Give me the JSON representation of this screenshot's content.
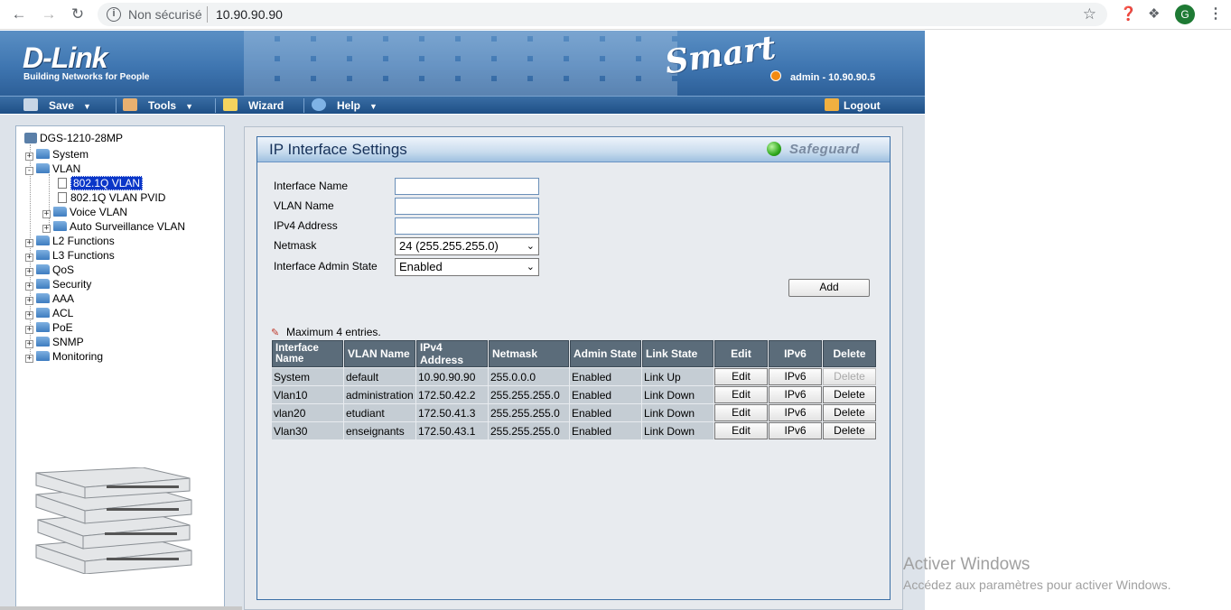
{
  "browser": {
    "back_icon": "arrow-left-icon",
    "security_label": "Non sécurisé",
    "url": "10.90.90.90",
    "avatar_letter": "G"
  },
  "header": {
    "logo": "D-Link",
    "tagline": "Building Networks for People",
    "brand_badge": "Smart",
    "user_info": "admin - 10.90.90.5"
  },
  "menubar": {
    "save": "Save",
    "tools": "Tools",
    "wizard": "Wizard",
    "help": "Help",
    "logout": "Logout"
  },
  "tree": {
    "root": "DGS-1210-28MP",
    "items": {
      "system": "System",
      "vlan": "VLAN",
      "vlan_8021q": "802.1Q VLAN",
      "vlan_pvid": "802.1Q VLAN PVID",
      "voice_vlan": "Voice VLAN",
      "auto_surv": "Auto Surveillance VLAN",
      "l2": "L2 Functions",
      "l3": "L3 Functions",
      "qos": "QoS",
      "security": "Security",
      "aaa": "AAA",
      "acl": "ACL",
      "poe": "PoE",
      "snmp": "SNMP",
      "monitoring": "Monitoring"
    }
  },
  "panel": {
    "title": "IP Interface Settings",
    "safeguard": "Safeguard"
  },
  "form": {
    "interface_name_label": "Interface Name",
    "vlan_name_label": "VLAN Name",
    "ipv4_label": "IPv4 Address",
    "netmask_label": "Netmask",
    "netmask_value": "24 (255.255.255.0)",
    "admin_state_label": "Interface Admin State",
    "admin_state_value": "Enabled",
    "add_button": "Add"
  },
  "note": "Maximum 4 entries.",
  "table": {
    "headers": {
      "interface_name": "Interface Name",
      "vlan_name": "VLAN Name",
      "ipv4": "IPv4 Address",
      "netmask": "Netmask",
      "admin_state": "Admin State",
      "link_state": "Link State",
      "edit": "Edit",
      "ipv6": "IPv6",
      "delete": "Delete"
    },
    "rows": [
      {
        "interface": "System",
        "vlan": "default",
        "ipv4": "10.90.90.90",
        "netmask": "255.0.0.0",
        "admin": "Enabled",
        "link": "Link Up",
        "edit": "Edit",
        "ipv6": "IPv6",
        "delete": "Delete"
      },
      {
        "interface": "Vlan10",
        "vlan": "administration",
        "ipv4": "172.50.42.2",
        "netmask": "255.255.255.0",
        "admin": "Enabled",
        "link": "Link Down",
        "edit": "Edit",
        "ipv6": "IPv6",
        "delete": "Delete"
      },
      {
        "interface": "vlan20",
        "vlan": "etudiant",
        "ipv4": "172.50.41.3",
        "netmask": "255.255.255.0",
        "admin": "Enabled",
        "link": "Link Down",
        "edit": "Edit",
        "ipv6": "IPv6",
        "delete": "Delete"
      },
      {
        "interface": "Vlan30",
        "vlan": "enseignants",
        "ipv4": "172.50.43.1",
        "netmask": "255.255.255.0",
        "admin": "Enabled",
        "link": "Link Down",
        "edit": "Edit",
        "ipv6": "IPv6",
        "delete": "Delete"
      }
    ]
  },
  "watermark": {
    "line1": "Activer Windows",
    "line2": "Accédez aux paramètres pour activer Windows."
  }
}
